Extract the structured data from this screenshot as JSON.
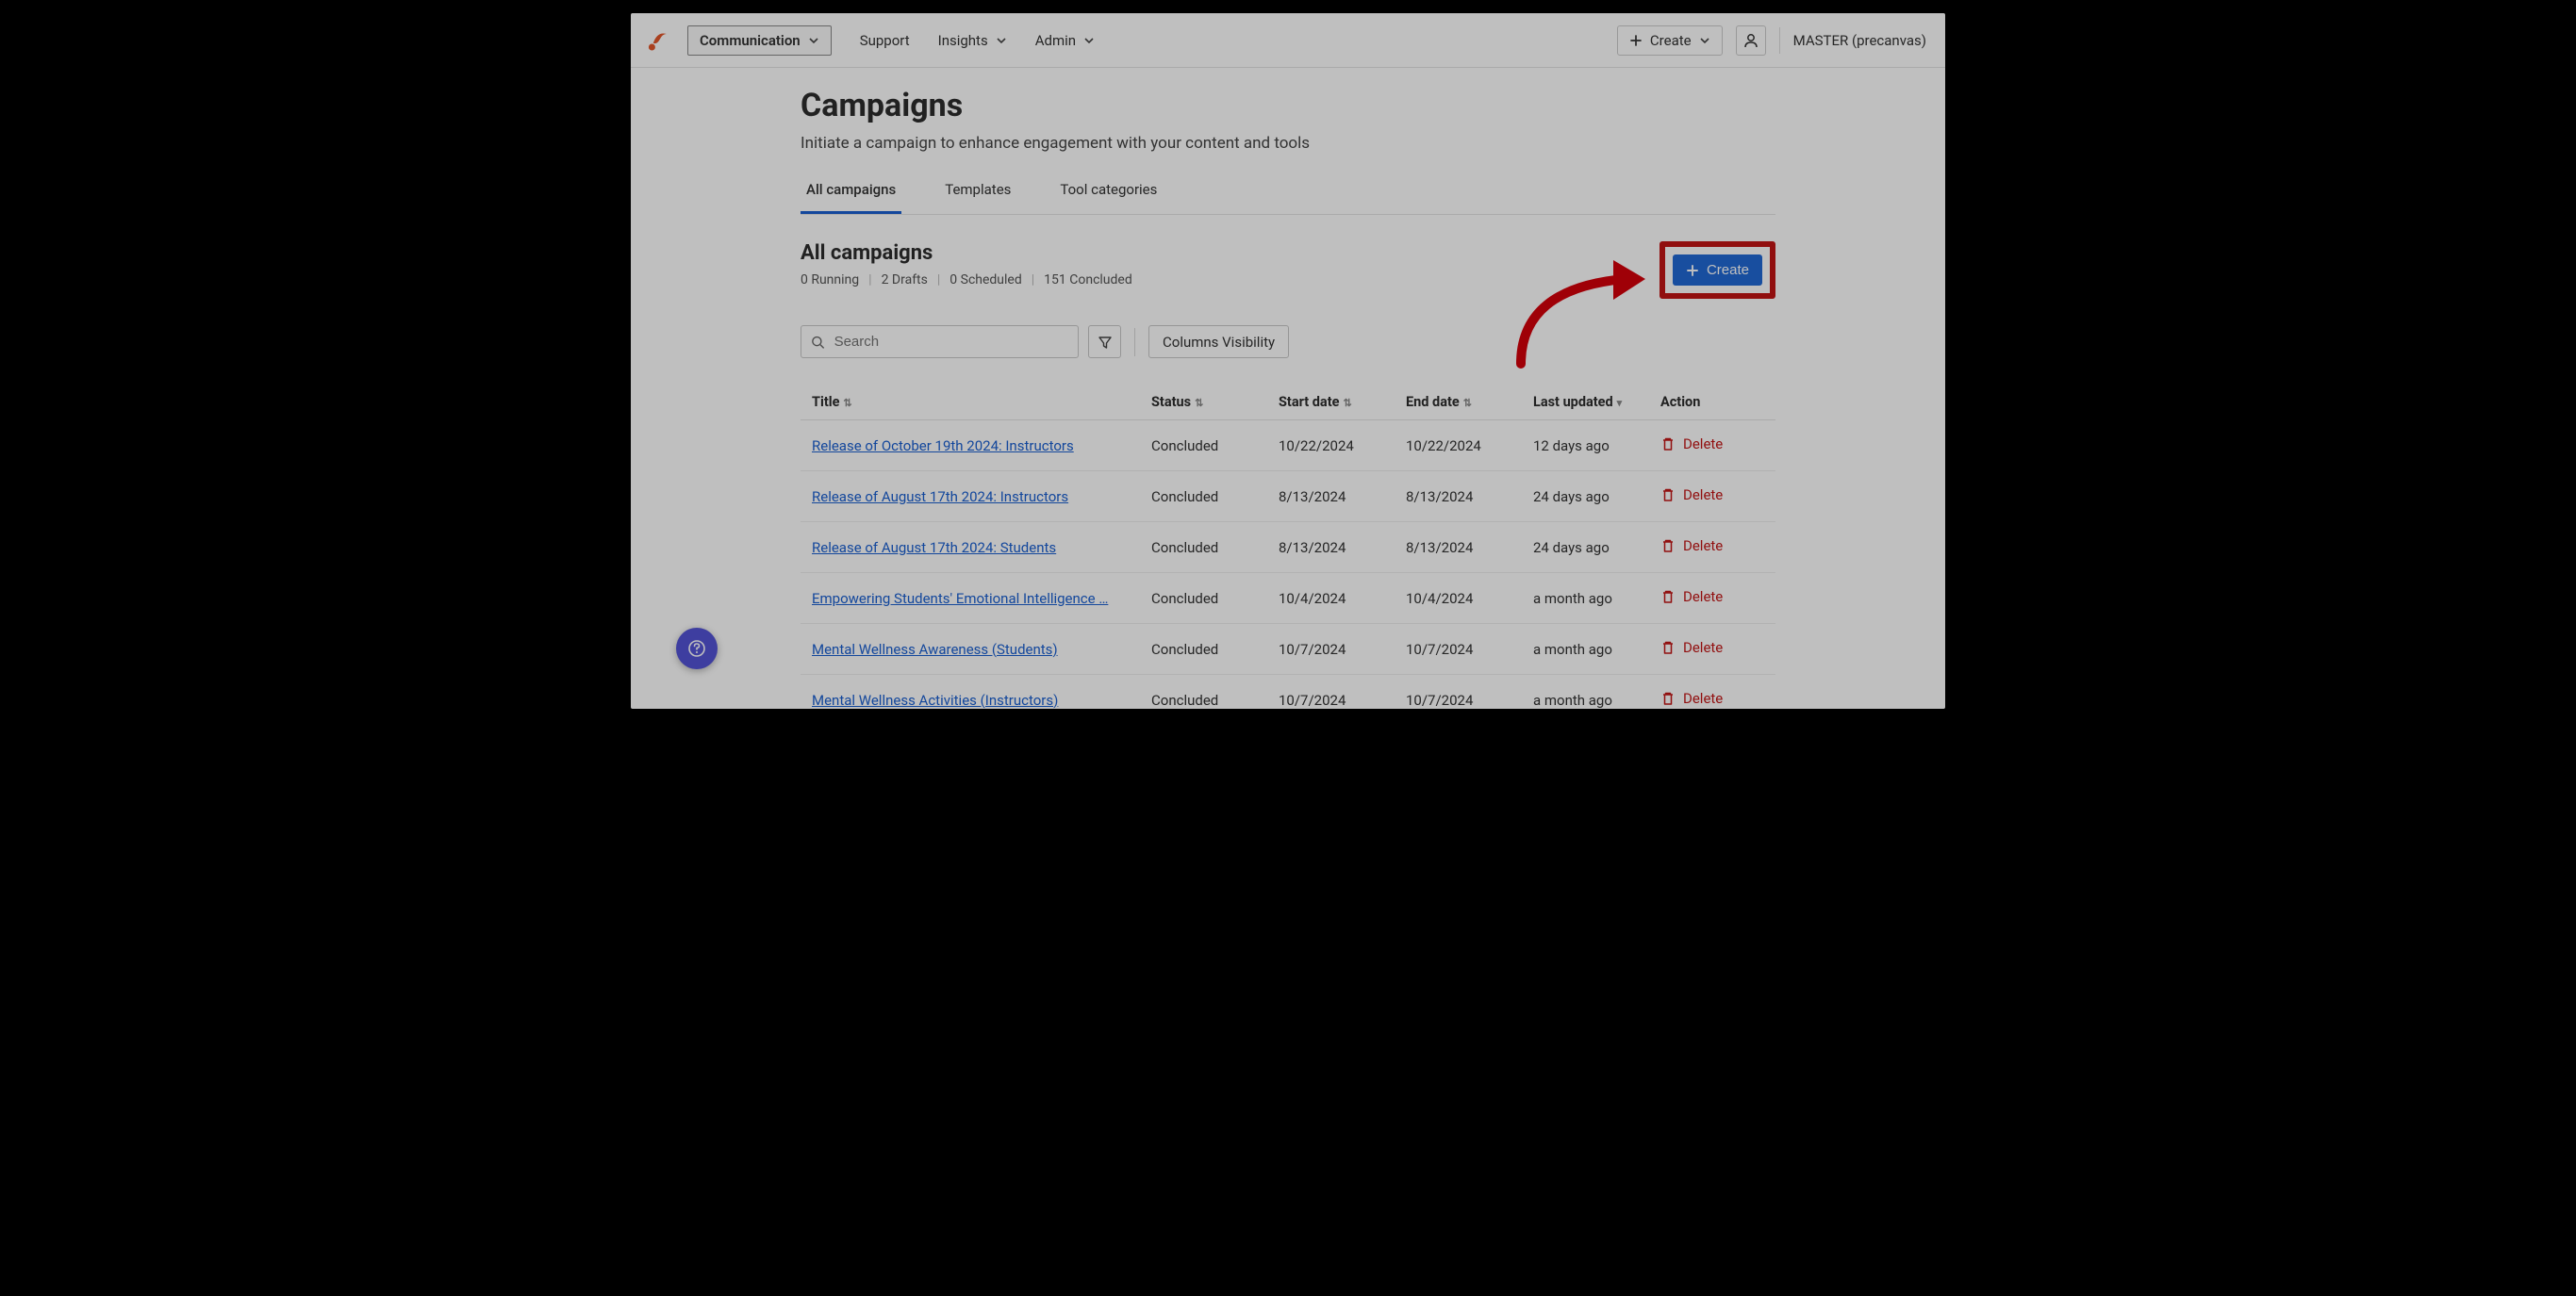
{
  "nav": {
    "communication": "Communication",
    "support": "Support",
    "insights": "Insights",
    "admin": "Admin",
    "create": "Create",
    "org": "MASTER (precanvas)"
  },
  "page": {
    "title": "Campaigns",
    "subtitle": "Initiate a campaign to enhance engagement with your content and tools"
  },
  "tabs": {
    "all": "All campaigns",
    "templates": "Templates",
    "tool_cats": "Tool categories"
  },
  "section": {
    "title": "All campaigns",
    "stats": {
      "running": "0 Running",
      "drafts": "2 Drafts",
      "scheduled": "0 Scheduled",
      "concluded": "151 Concluded"
    }
  },
  "create_btn": "Create",
  "toolbar": {
    "search_placeholder": "Search",
    "columns_visibility": "Columns Visibility"
  },
  "table": {
    "headers": {
      "title": "Title",
      "status": "Status",
      "start": "Start date",
      "end": "End date",
      "updated": "Last updated",
      "action": "Action"
    },
    "delete_label": "Delete",
    "rows": [
      {
        "title": "Release of October 19th 2024: Instructors",
        "status": "Concluded",
        "start": "10/22/2024",
        "end": "10/22/2024",
        "updated": "12 days ago"
      },
      {
        "title": "Release of August 17th 2024: Instructors",
        "status": "Concluded",
        "start": "8/13/2024",
        "end": "8/13/2024",
        "updated": "24 days ago"
      },
      {
        "title": "Release of August 17th 2024: Students",
        "status": "Concluded",
        "start": "8/13/2024",
        "end": "8/13/2024",
        "updated": "24 days ago"
      },
      {
        "title": "Empowering Students' Emotional Intelligence …",
        "status": "Concluded",
        "start": "10/4/2024",
        "end": "10/4/2024",
        "updated": "a month ago"
      },
      {
        "title": "Mental Wellness Awareness (Students)",
        "status": "Concluded",
        "start": "10/7/2024",
        "end": "10/7/2024",
        "updated": "a month ago"
      },
      {
        "title": "Mental Wellness Activities (Instructors)",
        "status": "Concluded",
        "start": "10/7/2024",
        "end": "10/7/2024",
        "updated": "a month ago"
      }
    ]
  }
}
